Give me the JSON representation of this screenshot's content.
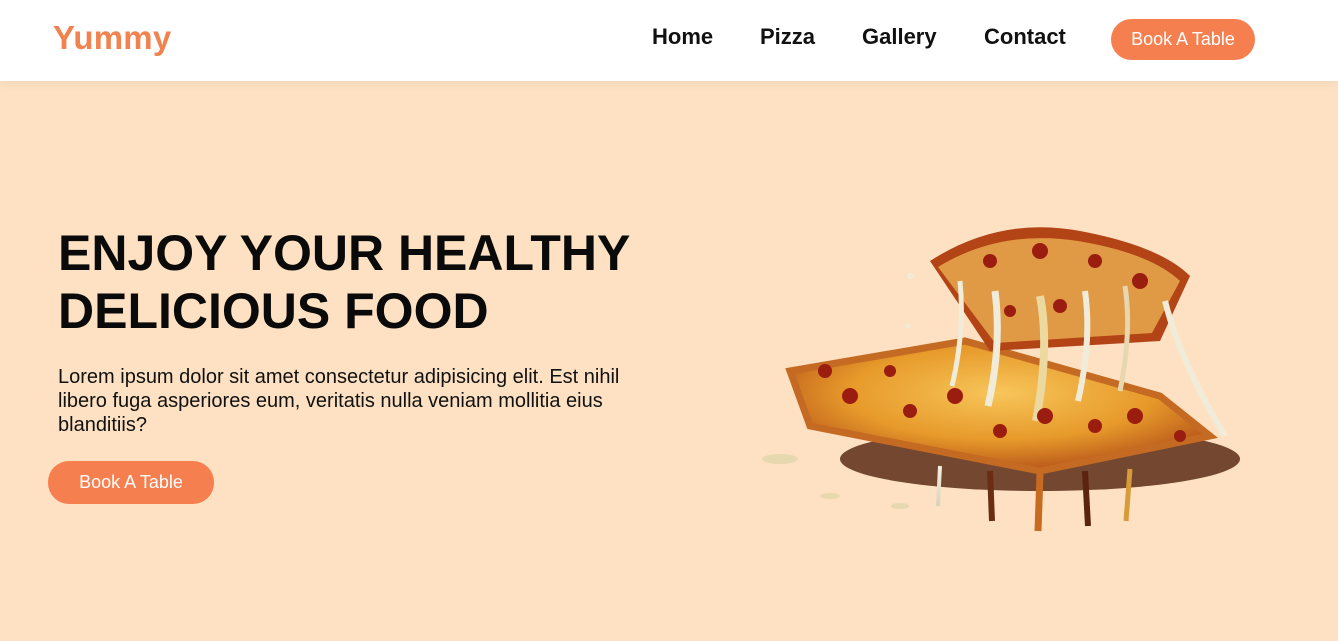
{
  "header": {
    "logo": "Yummy",
    "nav": [
      "Home",
      "Pizza",
      "Gallery",
      "Contact"
    ],
    "cta": "Book A Table"
  },
  "hero": {
    "title_line1": "ENJOY YOUR HEALTHY",
    "title_line2": "DELICIOUS FOOD",
    "description": "Lorem ipsum dolor sit amet consectetur adipisicing elit. Est nihil libero fuga asperiores eum, veritatis nulla veniam mollitia eius blanditiis?",
    "cta": "Book A Table",
    "image_icon": "pizza-image"
  },
  "colors": {
    "accent": "#f57f4f",
    "logo": "#f0834f",
    "background": "#fde1c2",
    "header_bg": "#ffffff"
  }
}
